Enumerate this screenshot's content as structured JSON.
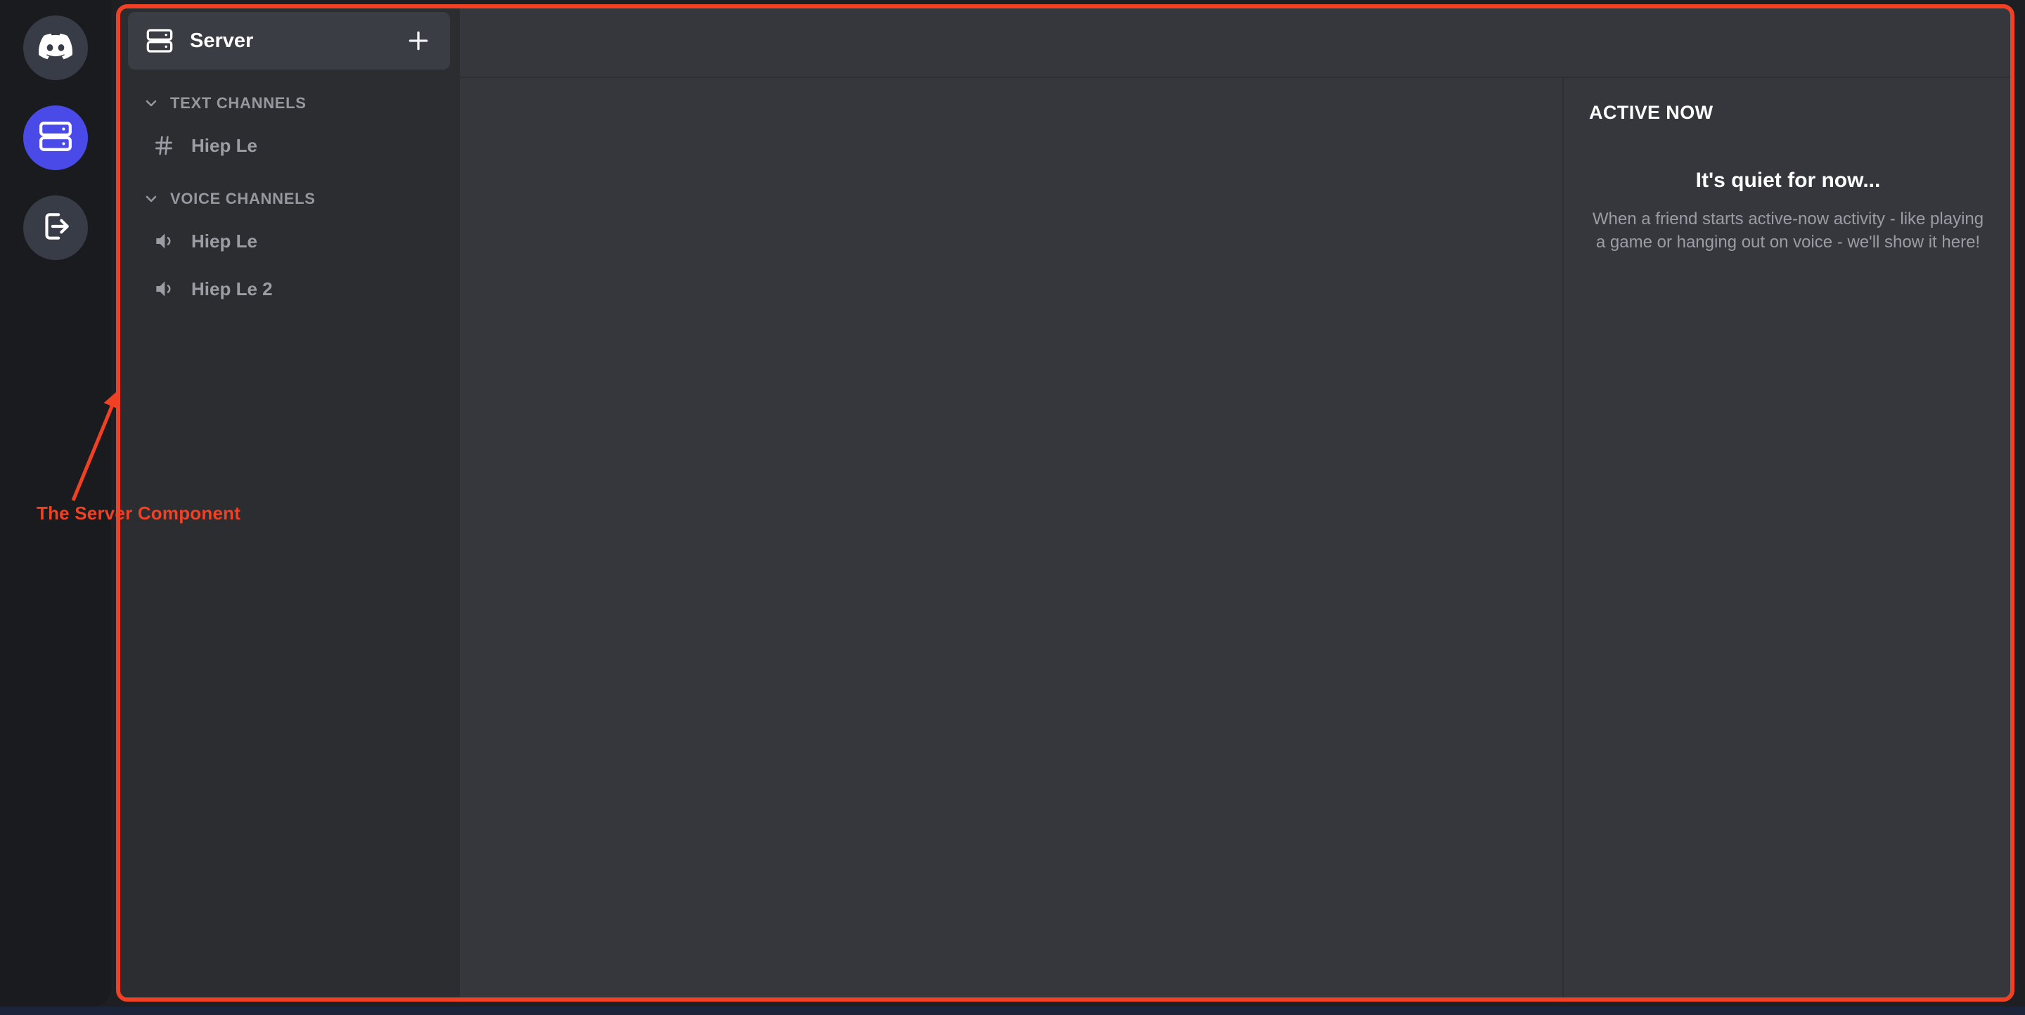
{
  "annotation": {
    "label": "The Server Component",
    "color": "#f04124",
    "arrow_icon": "arrow-up-right-icon"
  },
  "rail": {
    "items": [
      {
        "name": "discord-logo-icon",
        "label": "Discord",
        "active": false
      },
      {
        "name": "server-icon",
        "label": "Server",
        "active": true
      },
      {
        "name": "logout-icon",
        "label": "Logout",
        "active": false
      }
    ],
    "active_color": "#4a4ae8",
    "inactive_color": "#383c47"
  },
  "sidebar": {
    "header": {
      "icon": "server-rack-icon",
      "title": "Server",
      "add_icon": "plus-icon",
      "add_label": "Add"
    },
    "categories": [
      {
        "label": "TEXT CHANNELS",
        "chevron": "chevron-down-icon",
        "channels": [
          {
            "icon": "hash-icon",
            "name": "Hiep Le"
          }
        ]
      },
      {
        "label": "VOICE CHANNELS",
        "chevron": "chevron-down-icon",
        "channels": [
          {
            "icon": "speaker-icon",
            "name": "Hiep Le"
          },
          {
            "icon": "speaker-icon",
            "name": "Hiep Le 2"
          }
        ]
      }
    ]
  },
  "active_now": {
    "title": "ACTIVE NOW",
    "empty_title": "It's quiet for now...",
    "empty_body": "When a friend starts active-now activity - like playing a game or hanging out on voice - we'll show it here!"
  },
  "colors": {
    "app_bg": "#1e1f22",
    "rail_bg": "#1a1b1e",
    "sidebar_bg": "#2b2d31",
    "main_bg": "#35373c",
    "header_row_bg": "#3a3d44",
    "muted_text": "#9a9da3",
    "bottom_strip": "#1b2438"
  }
}
